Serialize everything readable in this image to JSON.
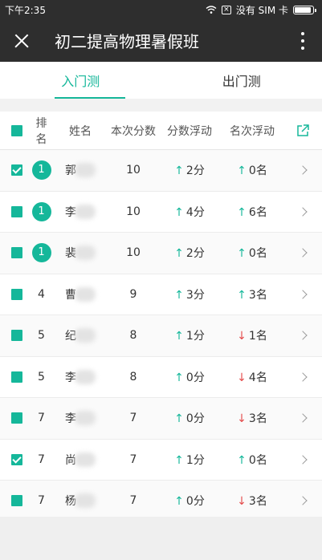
{
  "status": {
    "time": "下午2:35",
    "carrier": "没有 SIM 卡",
    "battery_level": 0.85
  },
  "appbar": {
    "title": "初二提高物理暑假班"
  },
  "tabs": [
    {
      "label": "入门测"
    },
    {
      "label": "出门测"
    }
  ],
  "table": {
    "headers": {
      "rank": "排名",
      "name": "姓名",
      "score": "本次分数",
      "score_delta": "分数浮动",
      "rank_delta": "名次浮动"
    },
    "rows": [
      {
        "checked": true,
        "rank": "1",
        "top": true,
        "name": "郭",
        "score": "10",
        "score_dir": "up",
        "score_delta": "2分",
        "rank_dir": "up",
        "rank_delta": "0名"
      },
      {
        "checked": false,
        "rank": "1",
        "top": true,
        "name": "李",
        "score": "10",
        "score_dir": "up",
        "score_delta": "4分",
        "rank_dir": "up",
        "rank_delta": "6名"
      },
      {
        "checked": false,
        "rank": "1",
        "top": true,
        "name": "裴",
        "score": "10",
        "score_dir": "up",
        "score_delta": "2分",
        "rank_dir": "up",
        "rank_delta": "0名"
      },
      {
        "checked": false,
        "rank": "4",
        "top": false,
        "name": "曹",
        "score": "9",
        "score_dir": "up",
        "score_delta": "3分",
        "rank_dir": "up",
        "rank_delta": "3名"
      },
      {
        "checked": false,
        "rank": "5",
        "top": false,
        "name": "纪",
        "score": "8",
        "score_dir": "up",
        "score_delta": "1分",
        "rank_dir": "down",
        "rank_delta": "1名"
      },
      {
        "checked": false,
        "rank": "5",
        "top": false,
        "name": "李",
        "score": "8",
        "score_dir": "up",
        "score_delta": "0分",
        "rank_dir": "down",
        "rank_delta": "4名"
      },
      {
        "checked": false,
        "rank": "7",
        "top": false,
        "name": "李",
        "score": "7",
        "score_dir": "up",
        "score_delta": "0分",
        "rank_dir": "down",
        "rank_delta": "3名"
      },
      {
        "checked": true,
        "rank": "7",
        "top": false,
        "name": "尚",
        "score": "7",
        "score_dir": "up",
        "score_delta": "1分",
        "rank_dir": "up",
        "rank_delta": "0名"
      },
      {
        "checked": false,
        "rank": "7",
        "top": false,
        "name": "杨",
        "score": "7",
        "score_dir": "up",
        "score_delta": "0分",
        "rank_dir": "down",
        "rank_delta": "3名"
      }
    ]
  },
  "colors": {
    "accent": "#15b79a",
    "up": "#15b79a",
    "down": "#e44c4c",
    "bar": "#2e2e2e"
  },
  "icons": {
    "arrow_up": "↑",
    "arrow_down": "↓"
  }
}
